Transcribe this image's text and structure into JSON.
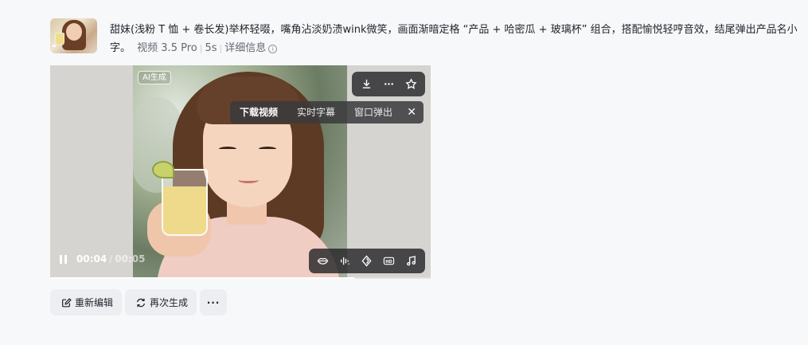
{
  "prompt": {
    "text": "甜妹(浅粉 T 恤 + 卷长发)举杯轻啜，嘴角沾淡奶渍wink微笑，画面渐暗定格 “产品 + 哈密瓜 + 玻璃杯” 组合，搭配愉悦轻哼音效，结尾弹出产品名小字。",
    "model": "视频 3.5 Pro",
    "duration": "5s",
    "details_label": "详细信息",
    "info_icon": "ⓘ"
  },
  "player": {
    "badge": "AI生成",
    "top_tools": [
      "download-icon",
      "more-icon",
      "star-icon"
    ],
    "tip_menu": {
      "items": [
        "下载视频",
        "实时字幕",
        "窗口弹出"
      ],
      "close": "✕"
    },
    "time_current": "00:04",
    "time_separator": "/",
    "time_total": "00:05",
    "progress_fraction": 0.8,
    "bottom_tools": [
      "lip-sync-icon",
      "voice-icon",
      "remix-icon",
      "hd-icon",
      "music-icon"
    ]
  },
  "actions": {
    "reedit": "重新编辑",
    "regenerate": "再次生成",
    "more": "···"
  }
}
